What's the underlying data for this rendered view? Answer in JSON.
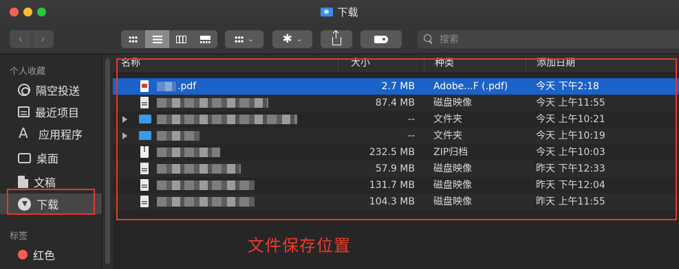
{
  "window": {
    "title": "下载"
  },
  "toolbar": {
    "back_label": "‹",
    "forward_label": "›",
    "search_placeholder": "搜索"
  },
  "sidebar": {
    "favorites_header": "个人收藏",
    "favorites": [
      {
        "label": "隔空投送",
        "icon": "airdrop-icon"
      },
      {
        "label": "最近项目",
        "icon": "recents-icon"
      },
      {
        "label": "应用程序",
        "icon": "applications-icon"
      },
      {
        "label": "桌面",
        "icon": "desktop-icon"
      },
      {
        "label": "文稿",
        "icon": "documents-icon"
      },
      {
        "label": "下载",
        "icon": "downloads-icon",
        "selected": true
      }
    ],
    "tags_header": "标签",
    "tags": [
      {
        "label": "红色",
        "color": "#ff5b51"
      }
    ]
  },
  "columns": {
    "name": "名称",
    "size": "大小",
    "kind": "种类",
    "date": "添加日期"
  },
  "files": [
    {
      "name": ".pdf",
      "size": "2.7 MB",
      "kind": "Adobe...F (.pdf)",
      "date": "今天 下午2:18",
      "icon": "pdf-file-icon",
      "selected": true
    },
    {
      "name": "",
      "size": "87.4 MB",
      "kind": "磁盘映像",
      "date": "今天 上午11:55",
      "icon": "disk-image-icon"
    },
    {
      "name": "",
      "size": "--",
      "kind": "文件夹",
      "date": "今天 上午10:21",
      "icon": "folder-icon"
    },
    {
      "name": "",
      "size": "--",
      "kind": "文件夹",
      "date": "今天 上午10:19",
      "icon": "folder-icon"
    },
    {
      "name": "",
      "size": "232.5 MB",
      "kind": "ZIP归档",
      "date": "今天 上午10:03",
      "icon": "zip-file-icon"
    },
    {
      "name": "",
      "size": "57.9 MB",
      "kind": "磁盘映像",
      "date": "昨天 下午12:33",
      "icon": "disk-image-icon"
    },
    {
      "name": "",
      "size": "131.7 MB",
      "kind": "磁盘映像",
      "date": "昨天 下午12:04",
      "icon": "disk-image-icon"
    },
    {
      "name": "",
      "size": "104.3 MB",
      "kind": "磁盘映像",
      "date": "昨天 上午11:55",
      "icon": "disk-image-icon"
    }
  ],
  "annotation": {
    "text": "文件保存位置",
    "color": "#e43a2c"
  }
}
